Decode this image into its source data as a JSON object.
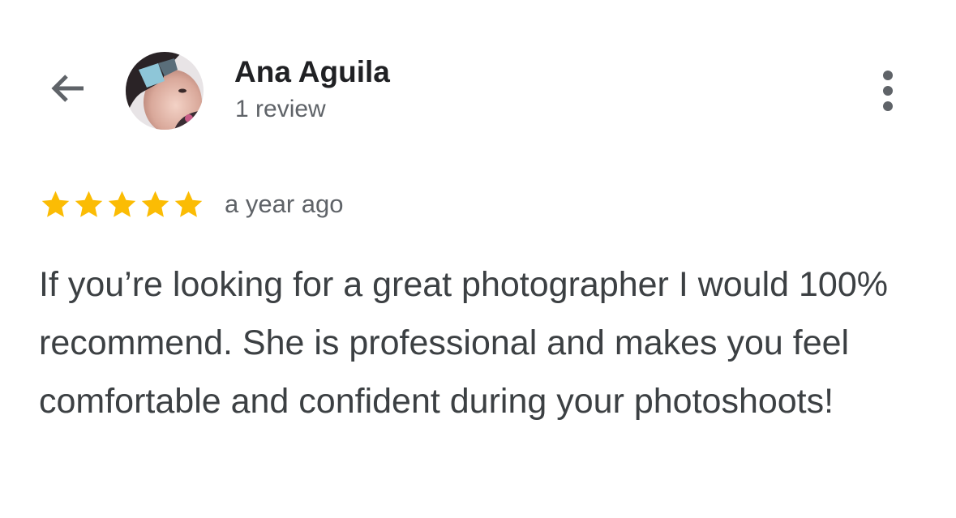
{
  "header": {
    "back_icon": "arrow-back-icon",
    "user_name": "Ana Aguila",
    "review_count": "1 review",
    "more_icon": "more-vert-icon"
  },
  "review": {
    "rating": 5,
    "rating_max": 5,
    "star_color": "#FBBC04",
    "timestamp": "a year ago",
    "text": "If you’re looking for a great photographer I would 100% recommend. She is professional and makes you feel comfortable and confident during your photoshoots!"
  }
}
